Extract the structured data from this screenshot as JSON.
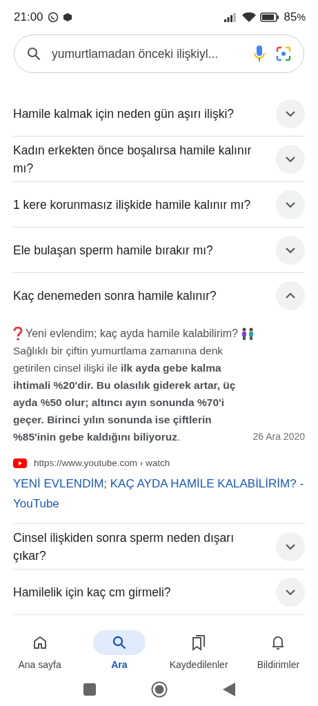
{
  "status_bar": {
    "time": "21:00",
    "battery": "85",
    "battery_unit": "%"
  },
  "search": {
    "value": "yumurtlamadan önceki ilişkiyl..."
  },
  "questions": [
    {
      "text": "Hamile kalmak için neden gün aşırı ilişki?",
      "expanded": false
    },
    {
      "text": "Kadın erkekten önce boşalırsa hamile kalınır mı?",
      "expanded": false
    },
    {
      "text": "1 kere korunmasız ilişkide hamile kalınır mı?",
      "expanded": false
    },
    {
      "text": "Ele bulaşan sperm hamile bırakır mı?",
      "expanded": false
    },
    {
      "text": "Kaç denemeden sonra hamile kalınır?",
      "expanded": true,
      "answer": {
        "question": "Yeni evlendim; kaç ayda hamile kalabilirim?",
        "body": "Sağlıklı bir çiftin yumurtlama zamanına denk getirilen cinsel ilişki ile **ilk ayda gebe kalma ihtimali %20'dir.** **Bu olasılık giderek artar, üç ayda %50 olur; altıncı ayın sonunda %70'i geçer.** **Birinci yılın sonunda ise çiftlerin %85'inin gebe kaldığını biliyoruz**.",
        "date": "26 Ara 2020",
        "source": "https://www.youtube.com › watch",
        "link": "YENİ EVLENDİM; KAÇ AYDA HAMİLE KALABİLİRİM? - YouTube"
      }
    },
    {
      "text": "Cinsel ilişkiden sonra sperm neden dışarı çıkar?",
      "expanded": false
    },
    {
      "text": "Hamilelik için kaç cm girmeli?",
      "expanded": false
    }
  ],
  "nav": [
    {
      "label": "Ana sayfa",
      "kind": "home",
      "selected": false
    },
    {
      "label": "Ara",
      "kind": "search",
      "selected": true
    },
    {
      "label": "Kaydedilenler",
      "kind": "saved",
      "selected": false
    },
    {
      "label": "Bildirimler",
      "kind": "bell",
      "selected": false
    }
  ]
}
